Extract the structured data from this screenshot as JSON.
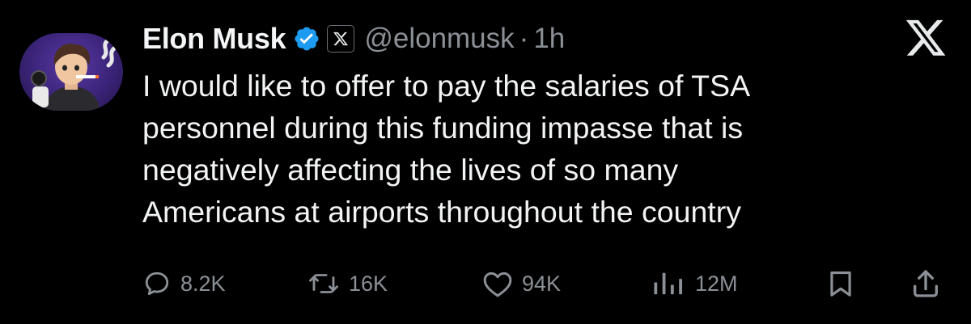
{
  "author": {
    "name": "Elon Musk",
    "handle": "@elonmusk",
    "separator": "·",
    "time": "1h",
    "avatar_icon": "avatar-cartoon-icon",
    "verified_color": "#1d9bf0"
  },
  "tweet": {
    "lines": [
      "I would like to offer to pay the salaries of TSA",
      "personnel during this funding impasse that is",
      "negatively affecting the lives of so many",
      "Americans at airports throughout the country"
    ]
  },
  "actions": {
    "reply": {
      "icon": "reply-icon",
      "count": "8.2K"
    },
    "repost": {
      "icon": "repost-icon",
      "count": "16K"
    },
    "like": {
      "icon": "heart-icon",
      "count": "94K"
    },
    "views": {
      "icon": "views-icon",
      "count": "12M"
    },
    "bookmark": {
      "icon": "bookmark-icon"
    },
    "share": {
      "icon": "share-icon"
    }
  },
  "colors": {
    "background": "#000000",
    "text": "#e7e9ea",
    "muted": "#8b9096",
    "accent": "#1d9bf0"
  }
}
